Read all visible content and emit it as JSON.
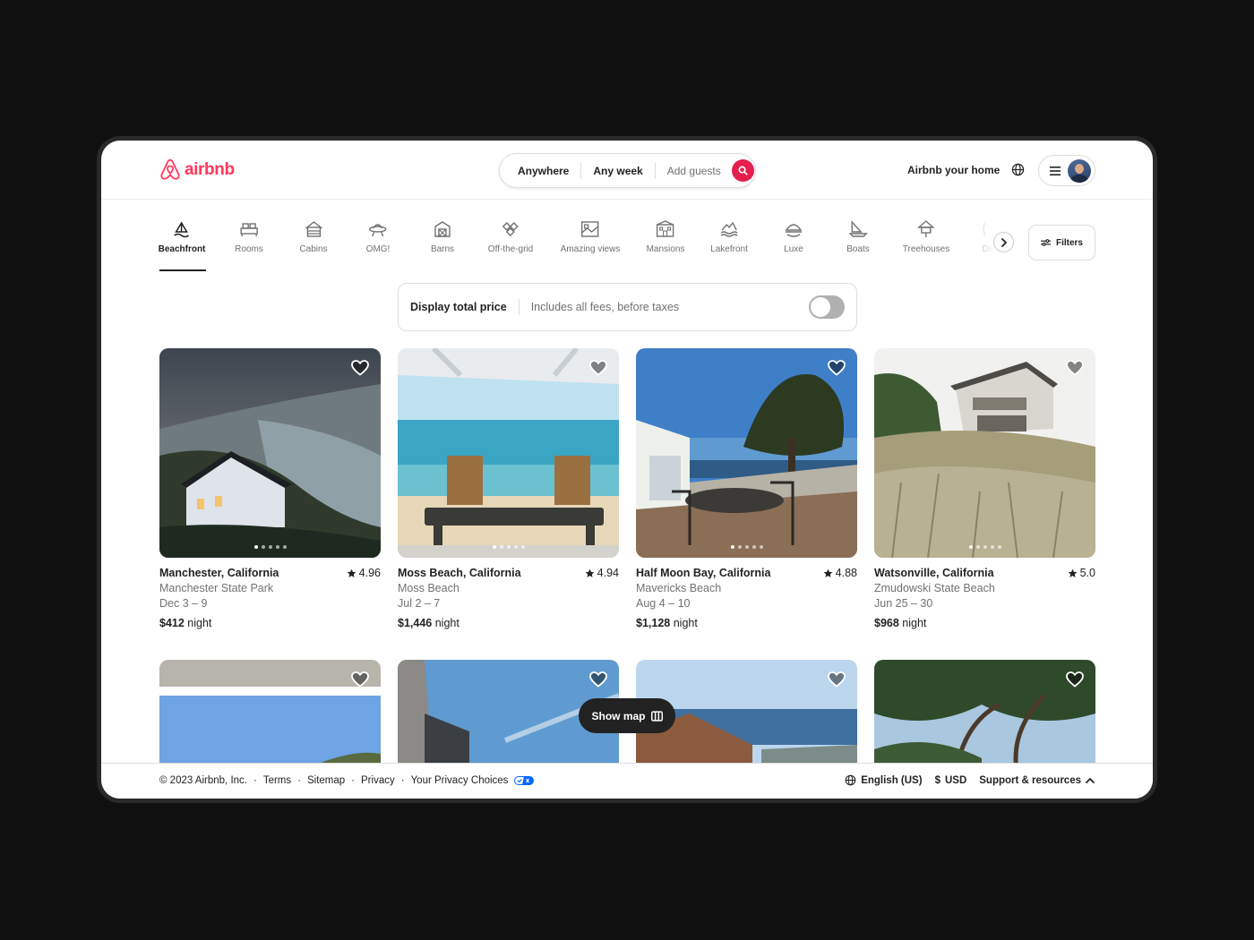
{
  "brand": {
    "name": "airbnb",
    "color": "#FF385C"
  },
  "search": {
    "where": "Anywhere",
    "when": "Any week",
    "who": "Add guests"
  },
  "header": {
    "host_link": "Airbnb your home"
  },
  "categories": [
    {
      "label": "Beachfront",
      "icon": "beachfront-icon",
      "active": true
    },
    {
      "label": "Rooms",
      "icon": "bed-icon"
    },
    {
      "label": "Cabins",
      "icon": "cabin-icon"
    },
    {
      "label": "OMG!",
      "icon": "ufo-icon"
    },
    {
      "label": "Barns",
      "icon": "barn-icon"
    },
    {
      "label": "Off-the-grid",
      "icon": "diamond-icon"
    },
    {
      "label": "Amazing views",
      "icon": "views-icon"
    },
    {
      "label": "Mansions",
      "icon": "mansion-icon"
    },
    {
      "label": "Lakefront",
      "icon": "lake-icon"
    },
    {
      "label": "Luxe",
      "icon": "luxe-icon"
    },
    {
      "label": "Boats",
      "icon": "boat-icon"
    },
    {
      "label": "Treehouses",
      "icon": "treehouse-icon"
    },
    {
      "label": "De",
      "icon": "partial-icon"
    }
  ],
  "filters_label": "Filters",
  "price_toggle": {
    "title": "Display total price",
    "subtitle": "Includes all fees, before taxes",
    "enabled": false
  },
  "listings": [
    {
      "title": "Manchester, California",
      "rating": "4.96",
      "place": "Manchester State Park",
      "dates": "Dec 3 – 9",
      "price": "$412",
      "unit": "night"
    },
    {
      "title": "Moss Beach, California",
      "rating": "4.94",
      "place": "Moss Beach",
      "dates": "Jul 2 – 7",
      "price": "$1,446",
      "unit": "night"
    },
    {
      "title": "Half Moon Bay, California",
      "rating": "4.88",
      "place": "Mavericks Beach",
      "dates": "Aug 4 – 10",
      "price": "$1,128",
      "unit": "night"
    },
    {
      "title": "Watsonville, California",
      "rating": "5.0",
      "place": "Zmudowski State Beach",
      "dates": "Jun 25 – 30",
      "price": "$968",
      "unit": "night"
    }
  ],
  "show_map_label": "Show map",
  "footer": {
    "copyright": "© 2023 Airbnb, Inc.",
    "links": [
      "Terms",
      "Sitemap",
      "Privacy",
      "Your Privacy Choices"
    ],
    "language": "English (US)",
    "currency_symbol": "$",
    "currency": "USD",
    "support": "Support & resources"
  }
}
